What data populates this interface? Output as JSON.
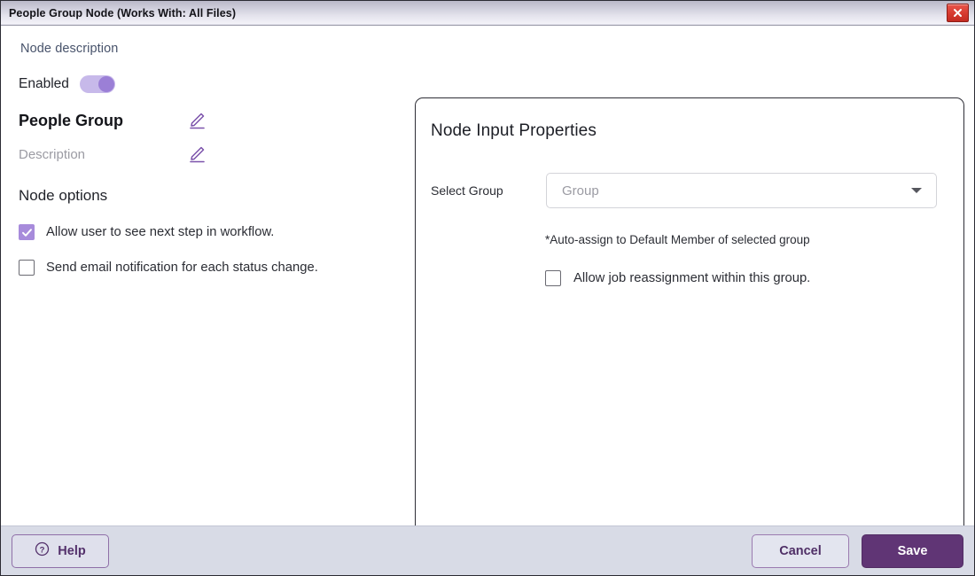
{
  "window": {
    "title": "People Group Node (Works With: All Files)",
    "close_icon": "close-icon"
  },
  "left": {
    "node_description_label": "Node description",
    "enabled_label": "Enabled",
    "enabled_state": "on",
    "node_name": "People Group",
    "node_name_edit_icon": "pencil-icon",
    "node_desc_placeholder": "Description",
    "node_desc_edit_icon": "pencil-icon",
    "node_options_title": "Node options",
    "options": [
      {
        "label": "Allow user to see next step in workflow.",
        "checked": true
      },
      {
        "label": "Send email notification for each status change.",
        "checked": false
      }
    ]
  },
  "panel": {
    "title": "Node Input Properties",
    "select_group_label": "Select Group",
    "select_group_value": "Group",
    "select_group_caret_icon": "chevron-down-icon",
    "hint": "*Auto-assign to Default Member of selected group",
    "reassignment_option": {
      "label": "Allow job reassignment within this group.",
      "checked": false
    }
  },
  "footer": {
    "help_label": "Help",
    "help_icon": "question-circle-icon",
    "cancel_label": "Cancel",
    "save_label": "Save"
  },
  "colors": {
    "accent_purple": "#603575",
    "toggle_track": "#c7b9ea",
    "toggle_knob": "#9b7fd6",
    "checkbox_checked": "#a78bdb",
    "footer_background": "#d8dbe6",
    "close_button_red": "#d63a30"
  }
}
